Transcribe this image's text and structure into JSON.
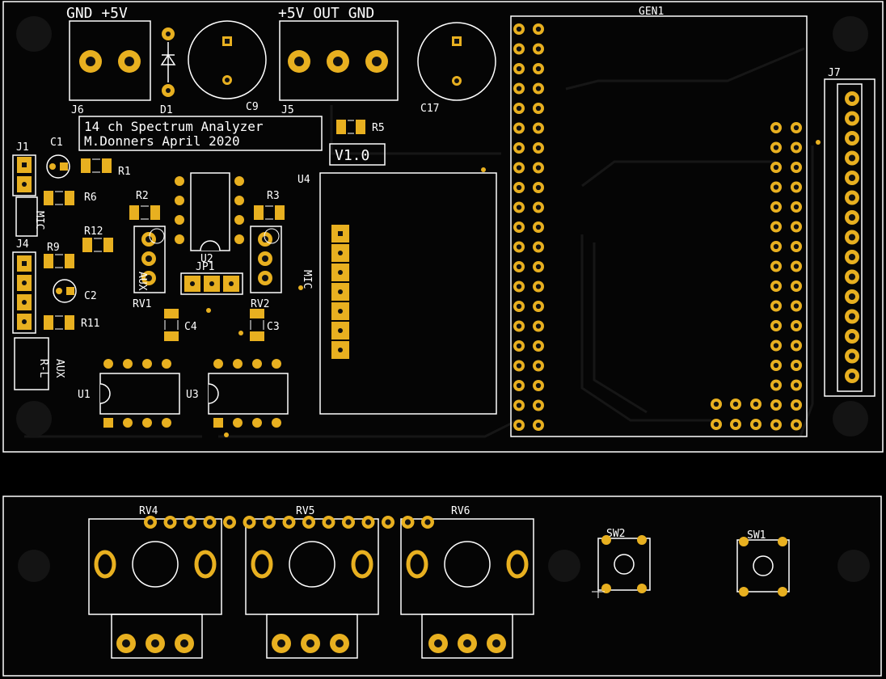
{
  "colors": {
    "board": "#050505",
    "outline": "#ffffff",
    "copper": "#e8b020",
    "copper_dark": "#c88f10",
    "pad_hole": "#111111",
    "trace": "#151515",
    "mount_hole": "#141414"
  },
  "main_board": {
    "connectors": {
      "j6_top": "GND  +5V",
      "j5_top": "+5V OUT GND"
    },
    "title_lines": [
      "14 ch Spectrum Analyzer",
      "M.Donners April 2020"
    ],
    "version": "V1.0",
    "labels": {
      "J6": "J6",
      "D1": "D1",
      "C9": "C9",
      "J5": "J5",
      "C17": "C17",
      "GEN1": "GEN1",
      "J7": "J7",
      "R5": "R5",
      "U4": "U4",
      "J1": "J1",
      "C1": "C1",
      "R1": "R1",
      "R6": "R6",
      "R2": "R2",
      "R3": "R3",
      "R12": "R12",
      "U2": "U2",
      "R9": "R9",
      "J4": "J4",
      "JP1": "JP1",
      "C2": "C2",
      "RV1": "RV1",
      "RV2": "RV2",
      "R11": "R11",
      "C4": "C4",
      "C3": "C3",
      "U1": "U1",
      "U3": "U3",
      "MIC": "MIC",
      "AUX": "AUX",
      "RL": "R-L"
    }
  },
  "front_panel": {
    "labels": {
      "RV4": "RV4",
      "RV5": "RV5",
      "RV6": "RV6",
      "SW2": "SW2",
      "SW1": "SW1"
    }
  }
}
